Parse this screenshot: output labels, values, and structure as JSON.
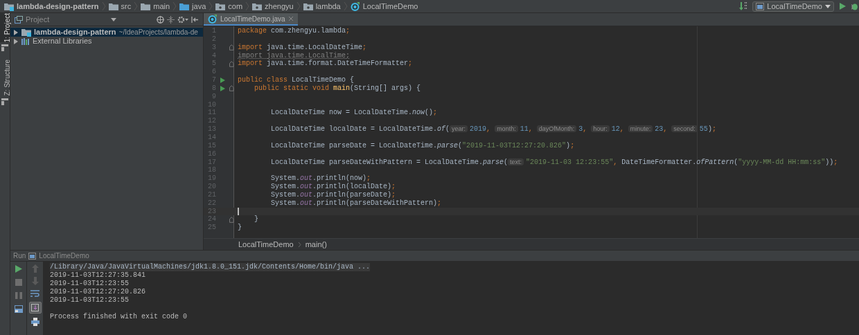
{
  "breadcrumbs": [
    {
      "label": "lambda-design-pattern",
      "kind": "module"
    },
    {
      "label": "src",
      "kind": "folder"
    },
    {
      "label": "main",
      "kind": "folder"
    },
    {
      "label": "java",
      "kind": "source"
    },
    {
      "label": "com",
      "kind": "package"
    },
    {
      "label": "zhengyu",
      "kind": "package"
    },
    {
      "label": "lambda",
      "kind": "package"
    },
    {
      "label": "LocalTimeDemo",
      "kind": "class"
    }
  ],
  "run_config": {
    "label": "LocalTimeDemo"
  },
  "tool_strip": [
    {
      "label": "1: Project",
      "selected": true
    },
    {
      "label": "Z: Structure",
      "selected": false
    }
  ],
  "project_panel": {
    "title": "Project",
    "tree": [
      {
        "label": "lambda-design-pattern",
        "path": "~/IdeaProjects/lambda-de",
        "kind": "module",
        "selected": true,
        "expanded": false
      },
      {
        "label": "External Libraries",
        "kind": "library",
        "selected": false,
        "expanded": false
      }
    ]
  },
  "editor_tabs": [
    {
      "label": "LocalTimeDemo.java",
      "selected": true
    }
  ],
  "code_lines": [
    {
      "number": "1",
      "current": false,
      "tokens": [
        {
          "text": "package",
          "kind": "keyword"
        },
        {
          "text": " com.zhengyu.lambda",
          "kind": "plain"
        },
        {
          "text": ";",
          "kind": "punct"
        }
      ]
    },
    {
      "number": "2",
      "current": false
    },
    {
      "number": "3",
      "current": false,
      "fold": true,
      "tokens": [
        {
          "text": "import",
          "kind": "keyword"
        },
        {
          "text": " java.time.LocalDateTime",
          "kind": "plain"
        },
        {
          "text": ";",
          "kind": "punct"
        }
      ]
    },
    {
      "number": "4",
      "current": false,
      "tokens": [
        {
          "text": "import java.time.LocalTime;",
          "kind": "unused"
        }
      ]
    },
    {
      "number": "5",
      "current": false,
      "fold": true,
      "tokens": [
        {
          "text": "import",
          "kind": "keyword"
        },
        {
          "text": " java.time.format.DateTimeFormatter",
          "kind": "plain"
        },
        {
          "text": ";",
          "kind": "punct"
        }
      ]
    },
    {
      "number": "6",
      "current": false
    },
    {
      "number": "7",
      "current": false,
      "run": true,
      "tokens": [
        {
          "text": "public class",
          "kind": "keyword"
        },
        {
          "text": " LocalTimeDemo {",
          "kind": "plain"
        }
      ]
    },
    {
      "number": "8",
      "current": false,
      "run": true,
      "fold": true,
      "tokens": [
        {
          "text": "    public static void ",
          "kind": "keyword"
        },
        {
          "text": "main",
          "kind": "declaration"
        },
        {
          "text": "(String[] args) {",
          "kind": "plain"
        }
      ]
    },
    {
      "number": "9",
      "current": false
    },
    {
      "number": "10",
      "current": false
    },
    {
      "number": "11",
      "current": false,
      "tokens": [
        {
          "text": "        LocalDateTime now = LocalDateTime.",
          "kind": "plain"
        },
        {
          "text": "now",
          "kind": "static"
        },
        {
          "text": "()",
          "kind": "plain"
        },
        {
          "text": ";",
          "kind": "punct"
        }
      ]
    },
    {
      "number": "12",
      "current": false
    },
    {
      "number": "13",
      "current": false,
      "tokens": [
        {
          "text": "        LocalDateTime localDate = LocalDateTime.",
          "kind": "plain"
        },
        {
          "text": "of",
          "kind": "static"
        },
        {
          "text": "(",
          "kind": "plain"
        },
        {
          "text": "year:",
          "kind": "hint"
        },
        {
          "text": "2019",
          "kind": "number"
        },
        {
          "text": ", ",
          "kind": "punct"
        },
        {
          "text": "month:",
          "kind": "hint"
        },
        {
          "text": "11",
          "kind": "number"
        },
        {
          "text": ", ",
          "kind": "punct"
        },
        {
          "text": "dayOfMonth:",
          "kind": "hint"
        },
        {
          "text": "3",
          "kind": "number"
        },
        {
          "text": ", ",
          "kind": "punct"
        },
        {
          "text": "hour:",
          "kind": "hint"
        },
        {
          "text": "12",
          "kind": "number"
        },
        {
          "text": ", ",
          "kind": "punct"
        },
        {
          "text": "minute:",
          "kind": "hint"
        },
        {
          "text": "23",
          "kind": "number"
        },
        {
          "text": ", ",
          "kind": "punct"
        },
        {
          "text": "second:",
          "kind": "hint"
        },
        {
          "text": "55",
          "kind": "number"
        },
        {
          "text": ")",
          "kind": "plain"
        },
        {
          "text": ";",
          "kind": "punct"
        }
      ]
    },
    {
      "number": "14",
      "current": false
    },
    {
      "number": "15",
      "current": false,
      "tokens": [
        {
          "text": "        LocalDateTime parseDate = LocalDateTime.",
          "kind": "plain"
        },
        {
          "text": "parse",
          "kind": "static"
        },
        {
          "text": "(",
          "kind": "plain"
        },
        {
          "text": "\"2019-11-03T12:27:20.826\"",
          "kind": "string"
        },
        {
          "text": ")",
          "kind": "plain"
        },
        {
          "text": ";",
          "kind": "punct"
        }
      ]
    },
    {
      "number": "16",
      "current": false
    },
    {
      "number": "17",
      "current": false,
      "tokens": [
        {
          "text": "        LocalDateTime parseDateWithPattern = LocalDateTime.",
          "kind": "plain"
        },
        {
          "text": "parse",
          "kind": "static"
        },
        {
          "text": "(",
          "kind": "plain"
        },
        {
          "text": "text:",
          "kind": "hint"
        },
        {
          "text": "\"2019-11-03 12:23:55\"",
          "kind": "string"
        },
        {
          "text": ", ",
          "kind": "punct"
        },
        {
          "text": "DateTimeFormatter.",
          "kind": "plain"
        },
        {
          "text": "ofPattern",
          "kind": "static"
        },
        {
          "text": "(",
          "kind": "plain"
        },
        {
          "text": "\"yyyy-MM-dd HH:mm:ss\"",
          "kind": "string"
        },
        {
          "text": "))",
          "kind": "plain"
        },
        {
          "text": ";",
          "kind": "punct"
        }
      ]
    },
    {
      "number": "18",
      "current": false
    },
    {
      "number": "19",
      "current": false,
      "tokens": [
        {
          "text": "        System.",
          "kind": "plain"
        },
        {
          "text": "out",
          "kind": "field"
        },
        {
          "text": ".println(now)",
          "kind": "plain"
        },
        {
          "text": ";",
          "kind": "punct"
        }
      ]
    },
    {
      "number": "20",
      "current": false,
      "tokens": [
        {
          "text": "        System.",
          "kind": "plain"
        },
        {
          "text": "out",
          "kind": "field"
        },
        {
          "text": ".println(localDate)",
          "kind": "plain"
        },
        {
          "text": ";",
          "kind": "punct"
        }
      ]
    },
    {
      "number": "21",
      "current": false,
      "tokens": [
        {
          "text": "        System.",
          "kind": "plain"
        },
        {
          "text": "out",
          "kind": "field"
        },
        {
          "text": ".println(parseDate)",
          "kind": "plain"
        },
        {
          "text": ";",
          "kind": "punct"
        }
      ]
    },
    {
      "number": "22",
      "current": false,
      "tokens": [
        {
          "text": "        System.",
          "kind": "plain"
        },
        {
          "text": "out",
          "kind": "field"
        },
        {
          "text": ".println(parseDateWithPattern)",
          "kind": "plain"
        },
        {
          "text": ";",
          "kind": "punct"
        }
      ]
    },
    {
      "number": "23",
      "current": true
    },
    {
      "number": "24",
      "current": false,
      "fold": true,
      "tokens": [
        {
          "text": "    }",
          "kind": "plain"
        }
      ]
    },
    {
      "number": "25",
      "current": false,
      "tokens": [
        {
          "text": "}",
          "kind": "plain"
        }
      ]
    }
  ],
  "editor_breadcrumbs": [
    "LocalTimeDemo",
    "main()"
  ],
  "run_panel": {
    "title": "Run",
    "config": "LocalTimeDemo",
    "output": [
      {
        "text": "/Library/Java/JavaVirtualMachines/jdk1.8.0_151.jdk/Contents/Home/bin/java ...",
        "kind": "command"
      },
      {
        "text": "2019-11-03T12:27:35.841",
        "kind": "stdout"
      },
      {
        "text": "2019-11-03T12:23:55",
        "kind": "stdout"
      },
      {
        "text": "2019-11-03T12:27:20.826",
        "kind": "stdout"
      },
      {
        "text": "2019-11-03T12:23:55",
        "kind": "stdout"
      },
      {
        "text": "Process finished with exit code 0",
        "kind": "exit"
      }
    ]
  }
}
